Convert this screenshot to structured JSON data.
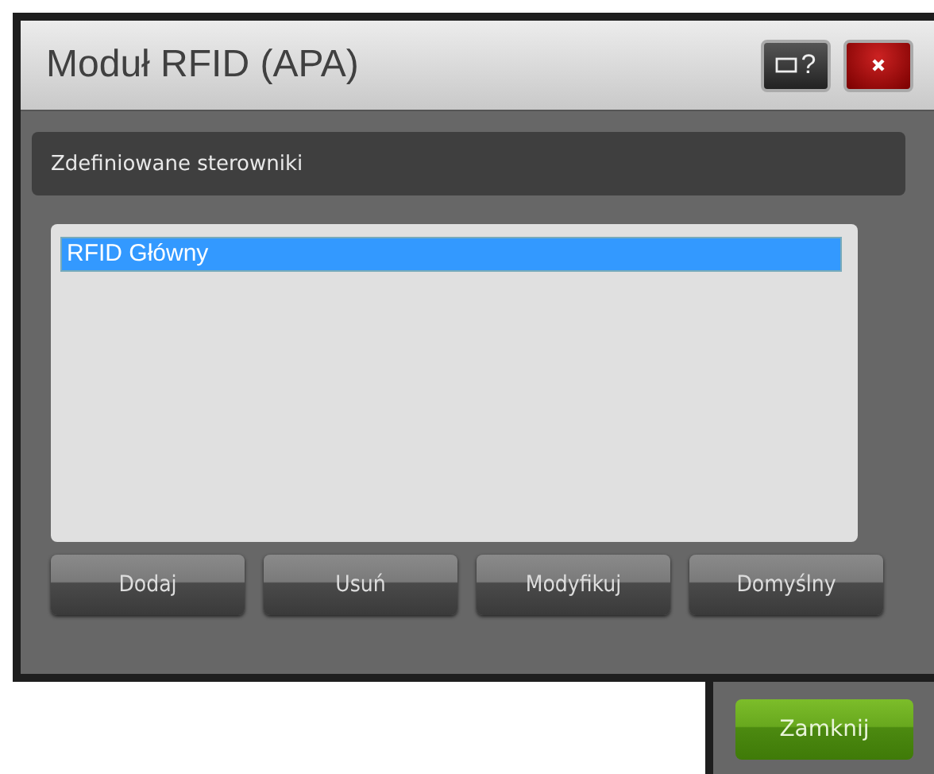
{
  "window": {
    "title": "Moduł RFID (APA)",
    "title_buttons": [
      {
        "kind": "help",
        "label": "?"
      },
      {
        "kind": "close"
      }
    ]
  },
  "section": {
    "title": "Zdefiniowane sterowniki"
  },
  "list": {
    "items": [
      {
        "label": "RFID Główny",
        "selected": true
      }
    ]
  },
  "buttons": [
    "Dodaj",
    "Usuń",
    "Modyfikuj",
    "Domyślny"
  ],
  "footer": {
    "buttons": [
      "Zamknij"
    ]
  }
}
